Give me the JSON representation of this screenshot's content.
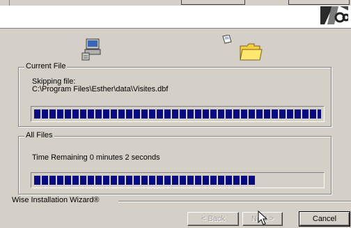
{
  "current_file": {
    "legend": "Current File",
    "status": "Skipping file:",
    "path": "C:\\Program Files\\Esther\\data\\Visites.dbf",
    "progress": 1.0
  },
  "all_files": {
    "legend": "All Files",
    "time_remaining": "Time Remaining 0 minutes 2 seconds",
    "progress": 0.77
  },
  "footer": {
    "brand": "Wise Installation Wizard®"
  },
  "buttons": {
    "back": "< Back",
    "next": "Next >",
    "cancel": "Cancel"
  },
  "icons": {
    "computer": "computer-icon",
    "folder": "folder-icon",
    "file": "file-flying-icon",
    "logo": "wise-logo-icon",
    "cursor": "mouse-cursor-icon"
  },
  "colors": {
    "progress_fill": "#0a0a80",
    "dialog_bg": "#d4d0c8"
  }
}
